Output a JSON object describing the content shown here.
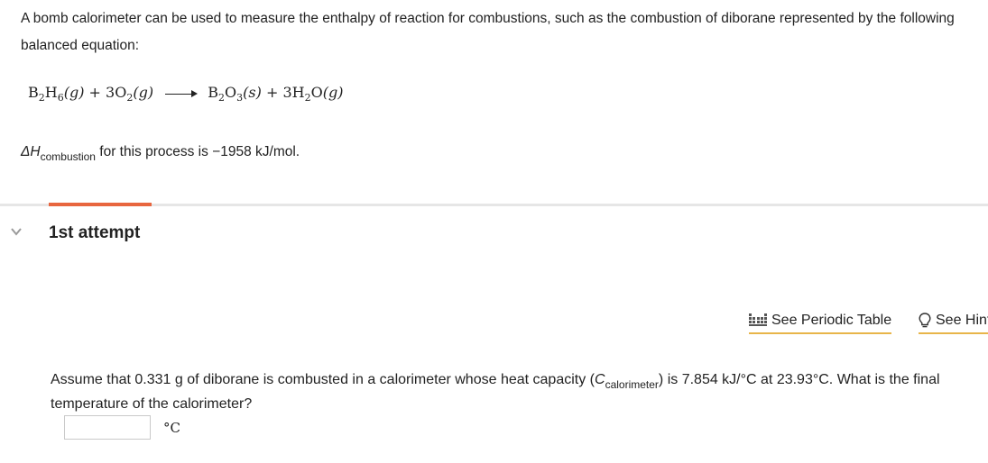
{
  "intro": {
    "text": "A bomb calorimeter can be used to measure the enthalpy of reaction for combustions, such as the combustion of diborane represented by the following balanced equation:"
  },
  "equation": {
    "r1_main": "B",
    "r1_s1": "2",
    "r1_mid": "H",
    "r1_s2": "6",
    "r1_state": "(g)",
    "plus1": "+ 3O",
    "r2_s": "2",
    "r2_state": "(g)",
    "p1_main": "B",
    "p1_s1": "2",
    "p1_mid": "O",
    "p1_s2": "3",
    "p1_state": "(s)",
    "plus2": "+ 3H",
    "p2_s": "2",
    "p2_mid": "O",
    "p2_state": "(g)"
  },
  "enthalpy": {
    "symbol": "ΔH",
    "subscript": "combustion",
    "text": " for this process is −1958 kJ/mol."
  },
  "attempt": {
    "title": "1st attempt",
    "accent_color": "#e8663f"
  },
  "tools": {
    "periodic_label": "See Periodic Table",
    "hint_label": "See Hint",
    "underline_color": "#e8b54a"
  },
  "question": {
    "part1": "Assume that 0.331 g of diborane is combusted in a calorimeter whose heat capacity (",
    "c_symbol": "C",
    "c_subscript": "calorimeter",
    "part2": ") is 7.854 kJ/°C at 23.93°C. What is the final temperature of the calorimeter?"
  },
  "answer": {
    "value": "",
    "unit": "°C"
  }
}
